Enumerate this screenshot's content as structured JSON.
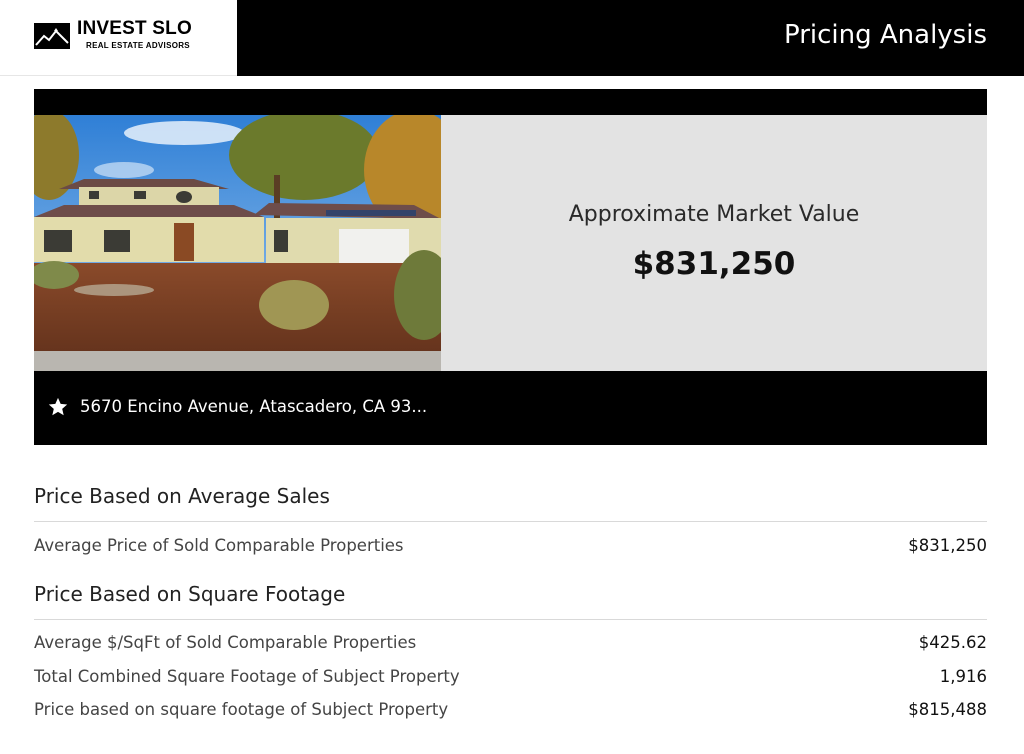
{
  "header": {
    "logo_title": "INVEST SLO",
    "logo_subtitle": "REAL ESTATE ADVISORS",
    "page_title": "Pricing Analysis"
  },
  "property": {
    "photo_icon": "house-photo",
    "value_label": "Approximate Market Value",
    "value_amount": "$831,250",
    "address_icon": "star-icon",
    "address": "5670 Encino Avenue, Atascadero, CA 93..."
  },
  "average_sales": {
    "title": "Price Based on Average Sales",
    "rows": [
      {
        "label": "Average Price of Sold Comparable Properties",
        "value": "$831,250"
      }
    ]
  },
  "square_footage": {
    "title": "Price Based on Square Footage",
    "rows": [
      {
        "label": "Average $/SqFt of Sold Comparable Properties",
        "value": "$425.62"
      },
      {
        "label": "Total Combined Square Footage of Subject Property",
        "value": "1,916"
      },
      {
        "label": "Price based on square footage of Subject Property",
        "value": "$815,488"
      }
    ]
  }
}
